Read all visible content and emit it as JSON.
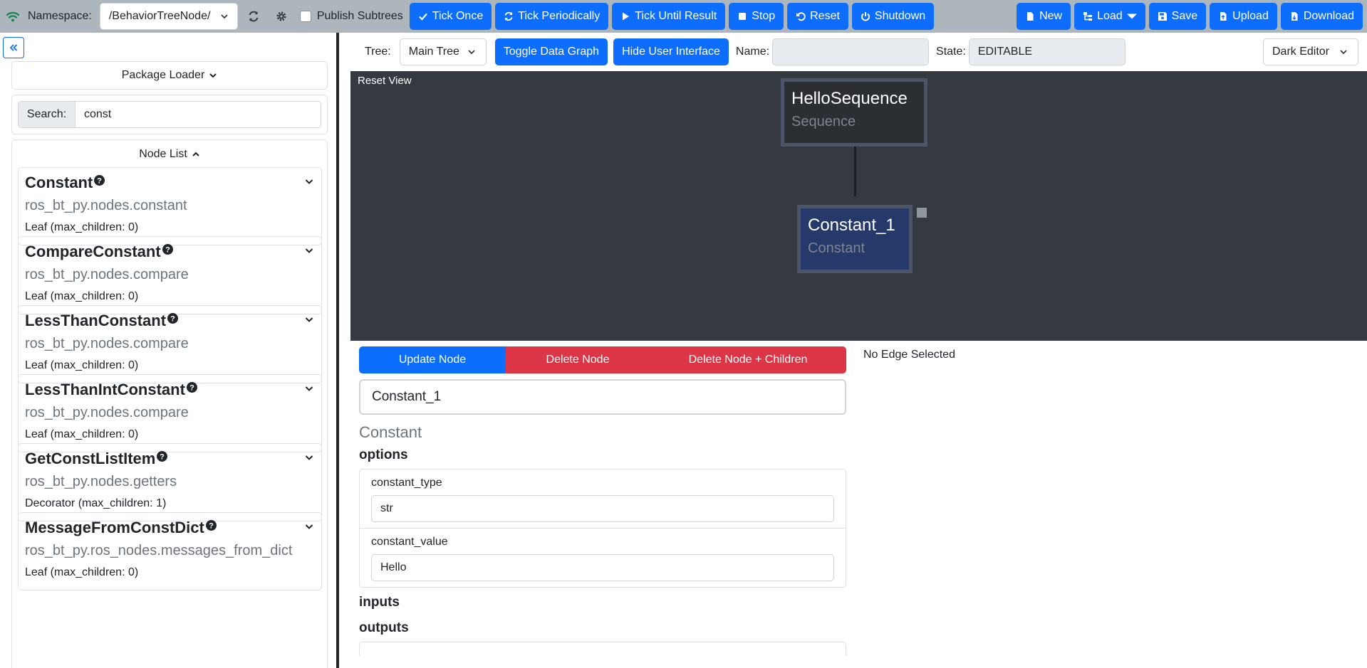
{
  "navbar": {
    "namespace_label": "Namespace:",
    "namespace_value": "/BehaviorTreeNode/",
    "publish_subtrees_label": "Publish Subtrees",
    "buttons": {
      "tick_once": "Tick Once",
      "tick_periodically": "Tick Periodically",
      "tick_until_result": "Tick Until Result",
      "stop": "Stop",
      "reset": "Reset",
      "shutdown": "Shutdown",
      "new": "New",
      "load": "Load",
      "save": "Save",
      "upload": "Upload",
      "download": "Download"
    },
    "icons": [
      "wifi-icon",
      "refresh-icon",
      "gear-icon",
      "check-icon",
      "sync-icon",
      "play-icon",
      "stop-icon",
      "undo-icon",
      "power-icon",
      "file-icon",
      "tree-icon",
      "save-icon",
      "file-upload-icon",
      "file-download-icon"
    ]
  },
  "sidebar": {
    "package_loader_label": "Package Loader",
    "search_label": "Search:",
    "search_value": "const",
    "node_list_label": "Node List",
    "nodes": [
      {
        "name": "Constant",
        "module": "ros_bt_py.nodes.constant",
        "kind": "Leaf (max_children: 0)"
      },
      {
        "name": "CompareConstant",
        "module": "ros_bt_py.nodes.compare",
        "kind": "Leaf (max_children: 0)"
      },
      {
        "name": "LessThanConstant",
        "module": "ros_bt_py.nodes.compare",
        "kind": "Leaf (max_children: 0)"
      },
      {
        "name": "LessThanIntConstant",
        "module": "ros_bt_py.nodes.compare",
        "kind": "Leaf (max_children: 0)"
      },
      {
        "name": "GetConstListItem",
        "module": "ros_bt_py.nodes.getters",
        "kind": "Decorator (max_children: 1)"
      },
      {
        "name": "MessageFromConstDict",
        "module": "ros_bt_py.ros_nodes.messages_from_dict",
        "kind": "Leaf (max_children: 0)"
      }
    ]
  },
  "toolbar": {
    "tree_label": "Tree:",
    "tree_value": "Main Tree",
    "toggle_data_graph": "Toggle Data Graph",
    "hide_user_interface": "Hide User Interface",
    "name_label": "Name:",
    "name_value": "",
    "state_label": "State:",
    "state_value": "EDITABLE",
    "theme_value": "Dark Editor"
  },
  "canvas": {
    "reset_view": "Reset View",
    "nodes": [
      {
        "name": "HelloSequence",
        "type": "Sequence"
      },
      {
        "name": "Constant_1",
        "type": "Constant"
      }
    ],
    "colors": {
      "background": "#343a40",
      "root_fill": "#2b2e33",
      "selected_fill": "#253a6b",
      "border": "#4a5568"
    }
  },
  "editor": {
    "update_node": "Update Node",
    "delete_node": "Delete Node",
    "delete_node_children": "Delete Node + Children",
    "node_name": "Constant_1",
    "node_type": "Constant",
    "options_title": "options",
    "options": [
      {
        "key": "constant_type",
        "value": "str"
      },
      {
        "key": "constant_value",
        "value": "Hello"
      }
    ],
    "inputs_title": "inputs",
    "outputs_title": "outputs"
  },
  "edge_status": "No Edge Selected",
  "colors": {
    "primary": "#0d6efd",
    "danger": "#dc3545",
    "navbar": "#adb5bd"
  }
}
